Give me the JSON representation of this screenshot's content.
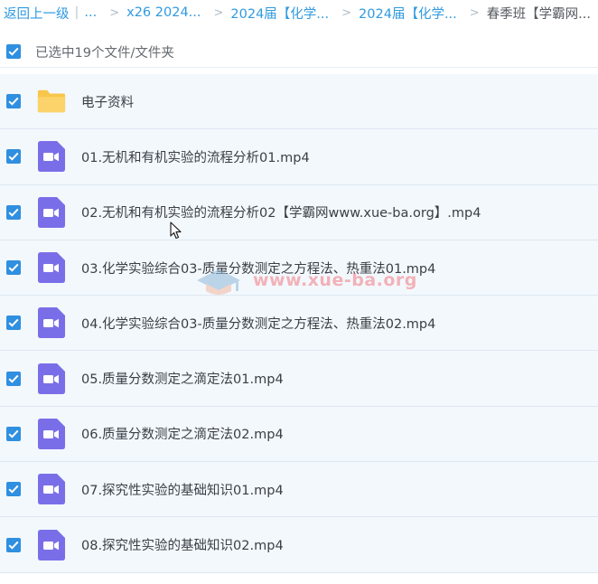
{
  "breadcrumb": {
    "back": "返回上一级",
    "divider": "|",
    "ellipsis": "...",
    "separator": ">",
    "crumb1": "x26 2024...",
    "crumb2": "2024届【化学...",
    "crumb3": "2024届【化学...",
    "current": "春季班【学霸网..."
  },
  "selection": {
    "label": "已选中19个文件/文件夹",
    "checked": true
  },
  "files": [
    {
      "name": "电子资料",
      "type": "folder",
      "checked": true
    },
    {
      "name": "01.无机和有机实验的流程分析01.mp4",
      "type": "video",
      "checked": true
    },
    {
      "name": "02.无机和有机实验的流程分析02【学霸网www.xue-ba.org】.mp4",
      "type": "video",
      "checked": true
    },
    {
      "name": "03.化学实验综合03-质量分数测定之方程法、热重法01.mp4",
      "type": "video",
      "checked": true
    },
    {
      "name": "04.化学实验综合03-质量分数测定之方程法、热重法02.mp4",
      "type": "video",
      "checked": true
    },
    {
      "name": "05.质量分数测定之滴定法01.mp4",
      "type": "video",
      "checked": true
    },
    {
      "name": "06.质量分数测定之滴定法02.mp4",
      "type": "video",
      "checked": true
    },
    {
      "name": "07.探究性实验的基础知识01.mp4",
      "type": "video",
      "checked": true
    },
    {
      "name": "08.探究性实验的基础知识02.mp4",
      "type": "video",
      "checked": true
    }
  ],
  "watermark": {
    "text": "www.xue-ba.org"
  },
  "icons": {
    "checkbox": "checkbox-checked-icon",
    "folder": "folder-icon",
    "video": "video-file-icon",
    "cursor": "mouse-cursor-icon"
  },
  "colors": {
    "link": "#2f9ae0",
    "checkbox": "#2f8fe0",
    "folder": "#f8c64a",
    "video": "#7a6ee8",
    "row_selected_bg": "#f3f8fd",
    "watermark": "#f07a80"
  }
}
